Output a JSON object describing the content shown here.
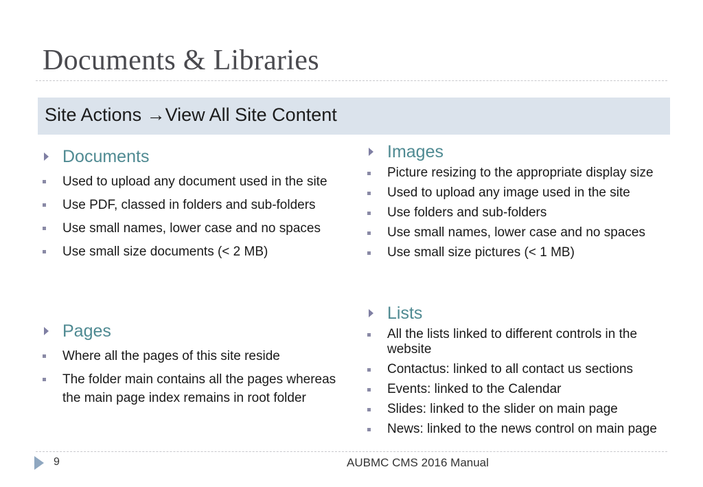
{
  "slide": {
    "title": "Documents & Libraries",
    "banner": {
      "part1": "Site Actions",
      "arrow": "→",
      "part2": "View All Site Content"
    }
  },
  "sections": {
    "documents": {
      "title": "Documents",
      "items": [
        "Used to upload any document used in the site",
        "Use PDF, classed in folders and sub-folders",
        "Use small names, lower case and no spaces",
        "Use small size documents (< 2 MB)"
      ]
    },
    "pages": {
      "title": "Pages",
      "items": [
        "Where all the pages of this site reside",
        "The folder main contains all the pages whereas the main page index remains in root folder"
      ]
    },
    "images": {
      "title": "Images",
      "items": [
        "Picture resizing to the appropriate display size",
        "Used to upload any image used in the site",
        "Use folders and sub-folders",
        "Use small names, lower case and no spaces",
        "Use small size pictures (< 1 MB)"
      ]
    },
    "lists": {
      "title": "Lists",
      "items": [
        "All the lists linked to different controls in the website",
        "Contactus: linked to all contact us sections",
        "Events: linked to the Calendar",
        "Slides: linked to the slider on main page",
        "News: linked to the news control on main page"
      ]
    }
  },
  "footer": {
    "page_number": "9",
    "text": "AUBMC CMS 2016 Manual"
  },
  "colors": {
    "heading": "#4f8a92",
    "banner_bg": "#dbe3ec",
    "bullet": "#8a8aa6"
  },
  "icons": {
    "section_caret": "caret-right-icon",
    "bullet": "square-bullet-icon",
    "footer_caret": "caret-right-icon"
  }
}
